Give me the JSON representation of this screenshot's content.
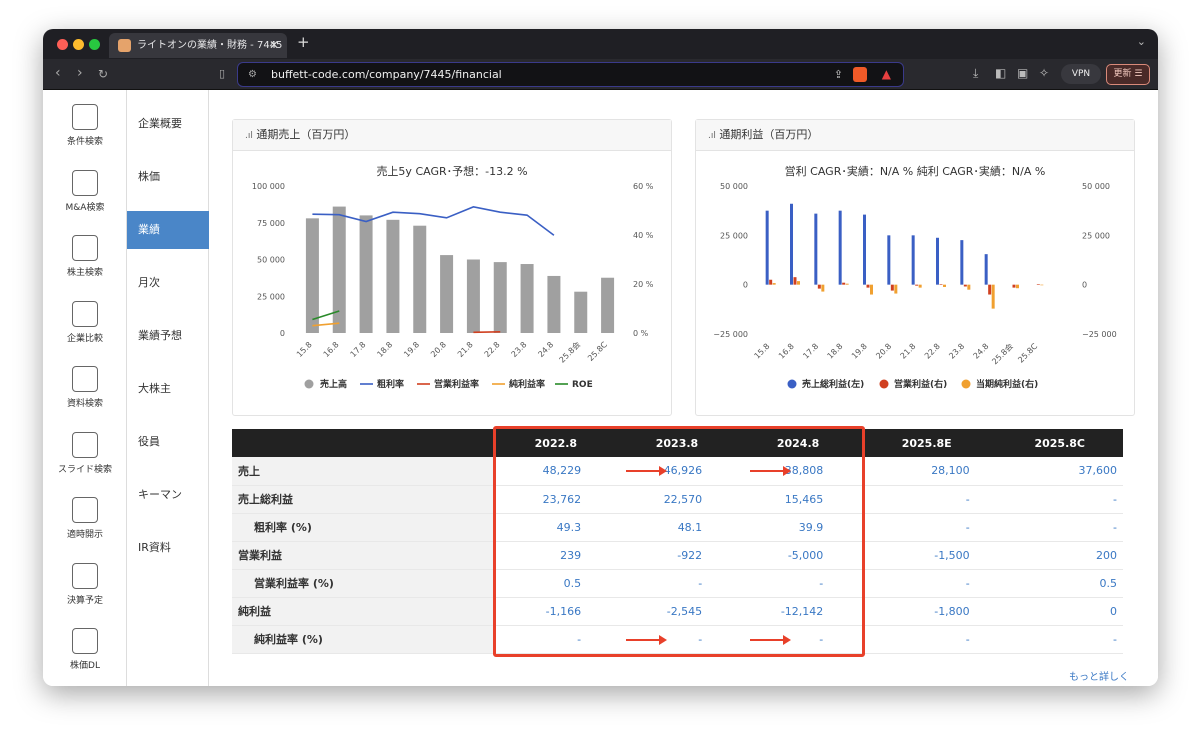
{
  "browser": {
    "tab_title": "ライトオンの業績・財務 - 7445",
    "url": "buffett-code.com/company/7445/financial",
    "vpn_label": "VPN",
    "update_label": "更新"
  },
  "sidebar": {
    "items": [
      {
        "label": "条件検索",
        "icon": "filter-icon"
      },
      {
        "label": "M&A検索",
        "icon": "handshake-icon"
      },
      {
        "label": "株主検索",
        "icon": "person-search-icon"
      },
      {
        "label": "企業比較",
        "icon": "compare-chart-icon"
      },
      {
        "label": "資料検索",
        "icon": "document-search-icon"
      },
      {
        "label": "スライド検索",
        "icon": "image-icon"
      },
      {
        "label": "適時開示",
        "icon": "stack-icon"
      },
      {
        "label": "決算予定",
        "icon": "calendar-icon"
      },
      {
        "label": "株価DL",
        "icon": "download-icon"
      }
    ]
  },
  "submenu": {
    "items": [
      "企業概要",
      "株価",
      "業績",
      "月次",
      "業績予想",
      "大株主",
      "役員",
      "キーマン",
      "IR資料"
    ],
    "active_index": 2
  },
  "chart1": {
    "header": "通期売上（百万円）",
    "title": "売上5y CAGR･予想：-13.2 %",
    "left_ticks": [
      "100 000",
      "75 000",
      "50 000",
      "25 000",
      "0"
    ],
    "right_ticks": [
      "60 %",
      "40 %",
      "20 %",
      "0 %"
    ],
    "legend": [
      {
        "name": "売上高",
        "color": "#a0a0a0",
        "shape": "dot"
      },
      {
        "name": "粗利率",
        "color": "#3a5fc4",
        "shape": "line"
      },
      {
        "name": "営業利益率",
        "color": "#d04020",
        "shape": "line"
      },
      {
        "name": "純利益率",
        "color": "#f0a030",
        "shape": "line"
      },
      {
        "name": "ROE",
        "color": "#2a8a2a",
        "shape": "line"
      }
    ]
  },
  "chart2": {
    "header": "通期利益（百万円）",
    "title": "営利 CAGR･実績：N/A %  純利 CAGR･実績：N/A %",
    "left_ticks": [
      "50 000",
      "25 000",
      "0",
      "−25 000"
    ],
    "right_ticks": [
      "50 000",
      "25 000",
      "0",
      "−25 000"
    ],
    "legend": [
      {
        "name": "売上総利益(左)",
        "color": "#3a5fc4"
      },
      {
        "name": "営業利益(右)",
        "color": "#d04020"
      },
      {
        "name": "当期純利益(右)",
        "color": "#f0a030"
      }
    ]
  },
  "chart_data": [
    {
      "type": "bar",
      "title": "売上5y CAGR･予想：-13.2 %",
      "categories": [
        "15.8",
        "16.8",
        "17.8",
        "18.8",
        "19.8",
        "20.8",
        "21.8",
        "22.8",
        "23.8",
        "24.8",
        "25.8会",
        "25.8C"
      ],
      "ylim": [
        0,
        100000
      ],
      "y2lim": [
        0,
        60
      ],
      "series": [
        {
          "name": "売上高",
          "axis": "left",
          "kind": "bar",
          "values": [
            78000,
            86000,
            80000,
            77000,
            73000,
            53000,
            50000,
            48229,
            46926,
            38808,
            28100,
            37600
          ]
        },
        {
          "name": "粗利率",
          "axis": "right",
          "kind": "line",
          "values": [
            48.5,
            48.3,
            45.5,
            49.3,
            48.7,
            47,
            51.5,
            49.3,
            48.1,
            39.9,
            null,
            null
          ]
        },
        {
          "name": "営業利益率",
          "axis": "right",
          "kind": "line",
          "values": [
            null,
            null,
            null,
            null,
            null,
            null,
            0.3,
            0.5,
            null,
            null,
            null,
            null
          ]
        },
        {
          "name": "純利益率",
          "axis": "right",
          "kind": "line",
          "values": [
            3,
            4,
            null,
            null,
            null,
            null,
            null,
            null,
            null,
            null,
            null,
            null
          ]
        },
        {
          "name": "ROE",
          "axis": "right",
          "kind": "line",
          "values": [
            5.5,
            9,
            null,
            null,
            null,
            null,
            null,
            null,
            null,
            null,
            null,
            null
          ]
        }
      ]
    },
    {
      "type": "bar",
      "title": "営利 CAGR･実績：N/A %  純利 CAGR･実績：N/A %",
      "categories": [
        "15.8",
        "16.8",
        "17.8",
        "18.8",
        "19.8",
        "20.8",
        "21.8",
        "22.8",
        "23.8",
        "24.8",
        "25.8会",
        "25.8C"
      ],
      "ylim": [
        -25000,
        50000
      ],
      "series": [
        {
          "name": "売上総利益(左)",
          "values": [
            37500,
            41000,
            36000,
            37500,
            35500,
            25000,
            25000,
            23762,
            22570,
            15465,
            null,
            null
          ]
        },
        {
          "name": "営業利益(右)",
          "values": [
            2500,
            3800,
            -2000,
            1000,
            -1500,
            -3000,
            -500,
            239,
            -922,
            -5000,
            -1500,
            200
          ]
        },
        {
          "name": "当期純利益(右)",
          "values": [
            800,
            1800,
            -3500,
            500,
            -5000,
            -4500,
            -1500,
            -1166,
            -2545,
            -12142,
            -1800,
            0
          ]
        }
      ]
    }
  ],
  "table": {
    "headers": [
      "",
      "2022.8",
      "2023.8",
      "2024.8",
      "2025.8E",
      "2025.8C"
    ],
    "rows": [
      {
        "label": "売上",
        "sub": false,
        "cells": [
          "48,229",
          "46,926",
          "38,808",
          "28,100",
          "37,600"
        ]
      },
      {
        "label": "売上総利益",
        "sub": false,
        "cells": [
          "23,762",
          "22,570",
          "15,465",
          "-",
          "-"
        ]
      },
      {
        "label": "粗利率 (%)",
        "sub": true,
        "cells": [
          "49.3",
          "48.1",
          "39.9",
          "-",
          "-"
        ]
      },
      {
        "label": "営業利益",
        "sub": false,
        "cells": [
          "239",
          "-922",
          "-5,000",
          "-1,500",
          "200"
        ]
      },
      {
        "label": "営業利益率 (%)",
        "sub": true,
        "cells": [
          "0.5",
          "-",
          "-",
          "-",
          "0.5"
        ]
      },
      {
        "label": "純利益",
        "sub": false,
        "cells": [
          "-1,166",
          "-2,545",
          "-12,142",
          "-1,800",
          "0"
        ]
      },
      {
        "label": "純利益率 (%)",
        "sub": true,
        "cells": [
          "-",
          "-",
          "-",
          "-",
          "-"
        ]
      }
    ]
  },
  "more_link": "もっと詳しく",
  "colors": {
    "accent": "#4a86c8",
    "highlight": "#e8402a"
  }
}
